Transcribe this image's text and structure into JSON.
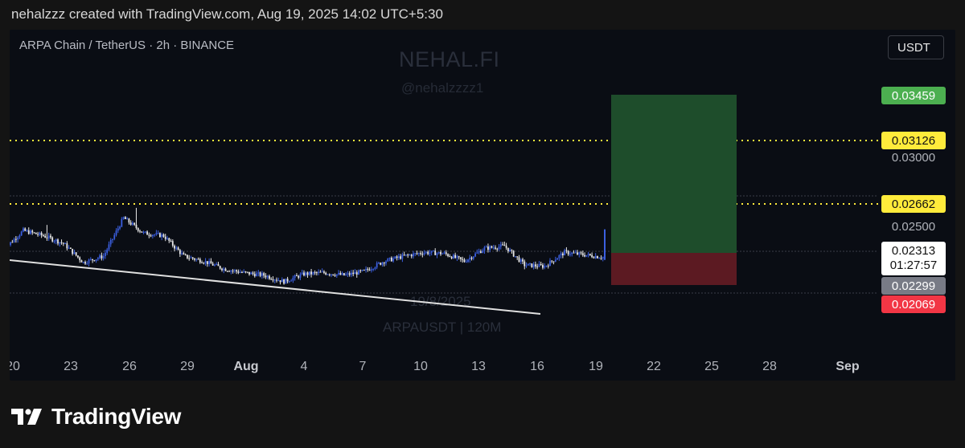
{
  "header": {
    "text": "nehalzzz created with TradingView.com, Aug 19, 2025 14:02 UTC+5:30"
  },
  "chart_header": {
    "symbol": "ARPA Chain / TetherUS · 2h · BINANCE",
    "currency": "USDT"
  },
  "watermarks": {
    "title": "NEHAL.FI",
    "handle": "@nehalzzzz1",
    "date": "19/8/2025",
    "pair": "ARPAUSDT | 120M"
  },
  "price_labels": {
    "target": "0.03459",
    "tp1": "0.03126",
    "level": "0.02662",
    "current": "0.02313",
    "countdown": "01:27:57",
    "entry": "0.02299",
    "stop": "0.02069"
  },
  "price_axis": [
    "0.03000",
    "0.02500"
  ],
  "x_ticks": [
    "20",
    "23",
    "26",
    "29",
    "Aug",
    "4",
    "7",
    "10",
    "13",
    "16",
    "19",
    "22",
    "25",
    "28",
    "Sep"
  ],
  "colors": {
    "up": "#3b5fe0",
    "down": "#e8e8e8",
    "tp": "#4caf50",
    "sl": "#f23645",
    "level": "#ffeb3b",
    "entry": "#787b86"
  },
  "brand": {
    "name": "TradingView"
  },
  "chart_data": {
    "type": "candlestick",
    "ylabel": "",
    "xlabel": "",
    "y_ticks": [
      0.03,
      0.025
    ],
    "horizontal_levels": [
      0.03126,
      0.02662
    ],
    "position": {
      "target": 0.03459,
      "entry": 0.02299,
      "stop": 0.02069
    },
    "last_price": 0.02313,
    "close_path": [
      [
        "Jul 20",
        0.0237
      ],
      [
        "Jul 21",
        0.0252
      ],
      [
        "Jul 22",
        0.0248
      ],
      [
        "Jul 23",
        0.0242
      ],
      [
        "Jul 24",
        0.0227
      ],
      [
        "Jul 25",
        0.0232
      ],
      [
        "Jul 26",
        0.0262
      ],
      [
        "Jul 27",
        0.025
      ],
      [
        "Jul 28",
        0.0248
      ],
      [
        "Jul 29",
        0.0232
      ],
      [
        "Jul 30",
        0.0228
      ],
      [
        "Jul 31",
        0.0222
      ],
      [
        "Aug 1",
        0.0219
      ],
      [
        "Aug 2",
        0.0217
      ],
      [
        "Aug 3",
        0.0212
      ],
      [
        "Aug 4",
        0.0218
      ],
      [
        "Aug 5",
        0.0219
      ],
      [
        "Aug 6",
        0.0217
      ],
      [
        "Aug 7",
        0.022
      ],
      [
        "Aug 8",
        0.0228
      ],
      [
        "Aug 9",
        0.0232
      ],
      [
        "Aug 10",
        0.0235
      ],
      [
        "Aug 11",
        0.0234
      ],
      [
        "Aug 12",
        0.0228
      ],
      [
        "Aug 13",
        0.0238
      ],
      [
        "Aug 14",
        0.024
      ],
      [
        "Aug 15",
        0.0225
      ],
      [
        "Aug 16",
        0.0224
      ],
      [
        "Aug 17",
        0.0235
      ],
      [
        "Aug 18",
        0.0233
      ],
      [
        "Aug 19",
        0.0231
      ]
    ]
  }
}
